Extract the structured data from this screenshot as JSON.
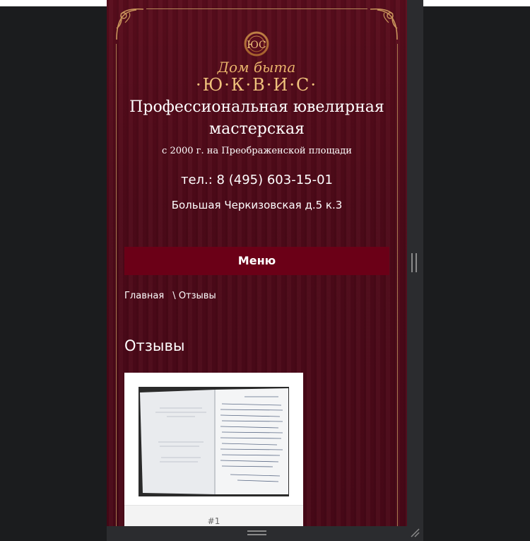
{
  "header": {
    "logo_script": "Дом быта",
    "logo_brand": "·Ю·К·В·И·С·",
    "logo_monogram": "ЮС",
    "headline": "Профессиональная ювелирная мастерская",
    "since": "с 2000 г. на Преображенской площади",
    "phone": "тел.: 8 (495) 603-15-01",
    "address": "Большая Черкизовская д.5 к.3"
  },
  "nav": {
    "menu_label": "Меню"
  },
  "breadcrumb": {
    "home": "Главная",
    "separator": "\\",
    "current": "Отзывы"
  },
  "main": {
    "title": "Отзывы",
    "cards": [
      {
        "caption": "#1"
      }
    ]
  },
  "colors": {
    "background": "#4f0a19",
    "menu_button": "#6b0017",
    "gold": "#d9a65e"
  },
  "icons": {
    "corner_ornament": "ornament-icon",
    "scroll_handle": "resize-handle-icon"
  }
}
